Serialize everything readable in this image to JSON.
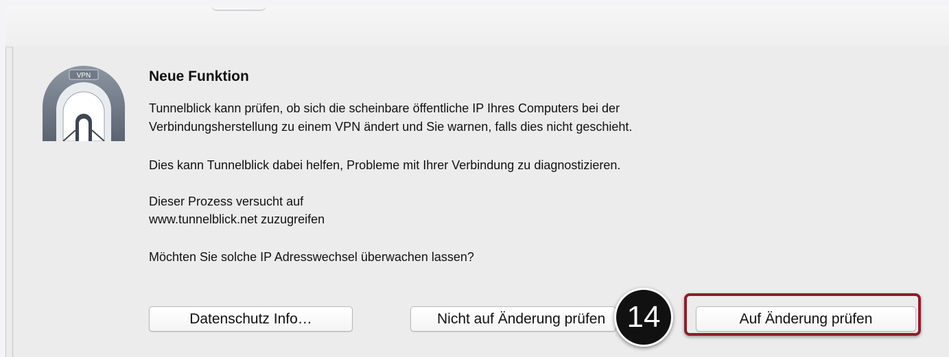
{
  "dialog": {
    "app_icon_badge": "VPN",
    "title": "Neue Funktion",
    "paragraph1_line1": "Tunnelblick kann prüfen, ob sich die scheinbare öffentliche IP Ihres Computers bei der",
    "paragraph1_line2": "Verbindungsherstellung zu einem VPN ändert und Sie warnen, falls dies nicht geschieht.",
    "paragraph2": "Dies kann Tunnelblick dabei helfen, Probleme mit Ihrer Verbindung zu diagnostizieren.",
    "paragraph3_line1": "Dieser Prozess versucht auf",
    "paragraph3_line2": "www.tunnelblick.net zuzugreifen",
    "question": "Möchten Sie solche IP Adresswechsel überwachen lassen?",
    "buttons": {
      "privacy_label": "Datenschutz Info…",
      "dont_check_label": "Nicht auf Änderung prüfen",
      "check_label": "Auf Änderung prüfen"
    }
  },
  "annotation": {
    "step_number": "14",
    "highlight_color": "#8c1f25"
  }
}
